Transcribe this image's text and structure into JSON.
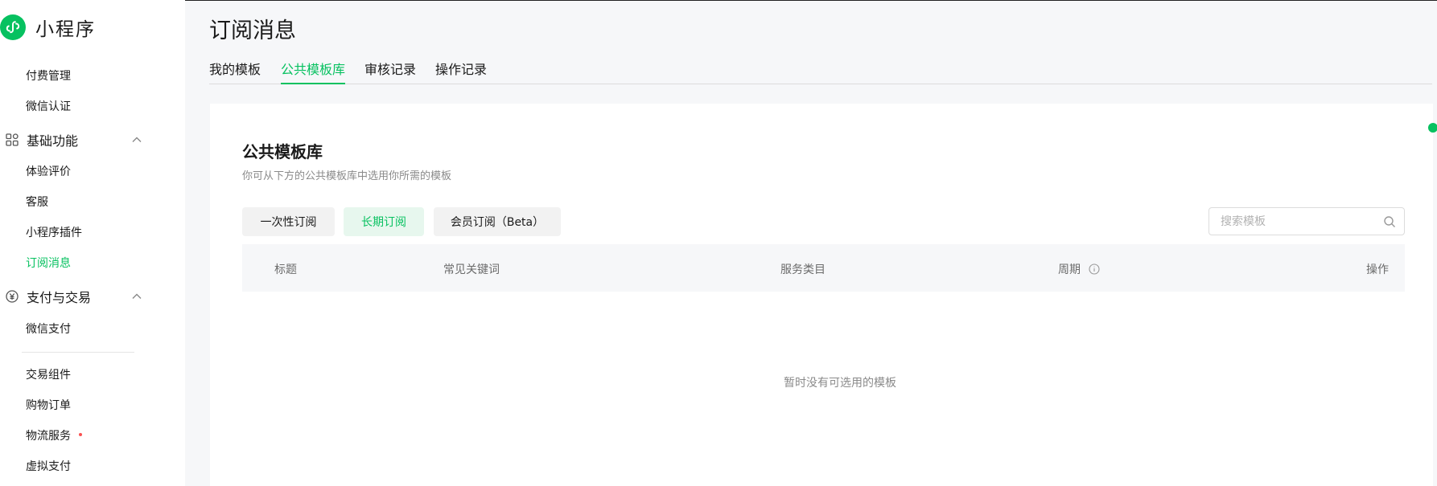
{
  "app": {
    "name": "小程序",
    "brand_color": "#07c160"
  },
  "sidebar": {
    "items": [
      {
        "label": "付费管理"
      },
      {
        "label": "微信认证"
      }
    ],
    "group_basic": {
      "label": "基础功能",
      "icon": "grid-icon",
      "expanded": true,
      "items": [
        {
          "label": "体验评价"
        },
        {
          "label": "客服"
        },
        {
          "label": "小程序插件"
        },
        {
          "label": "订阅消息",
          "active": true
        }
      ]
    },
    "group_pay": {
      "label": "支付与交易",
      "icon": "yuan-icon",
      "expanded": true,
      "items": [
        {
          "label": "微信支付"
        },
        {
          "label": "交易组件"
        },
        {
          "label": "购物订单"
        },
        {
          "label": "物流服务",
          "badge": "red-dot"
        },
        {
          "label": "虚拟支付"
        }
      ]
    }
  },
  "header": {
    "title": "订阅消息",
    "tabs": [
      {
        "label": "我的模板"
      },
      {
        "label": "公共模板库",
        "active": true
      },
      {
        "label": "审核记录"
      },
      {
        "label": "操作记录"
      }
    ]
  },
  "main": {
    "title": "公共模板库",
    "description": "你可从下方的公共模板库中选用你所需的模板",
    "filters": [
      {
        "label": "一次性订阅"
      },
      {
        "label": "长期订阅",
        "active": true
      },
      {
        "label": "会员订阅（Beta）"
      }
    ],
    "search": {
      "placeholder": "搜索模板",
      "value": ""
    },
    "table": {
      "columns": [
        "标题",
        "常见关键词",
        "服务类目",
        "周期",
        "操作"
      ],
      "rows": []
    },
    "empty_text": "暂时没有可选用的模板"
  }
}
